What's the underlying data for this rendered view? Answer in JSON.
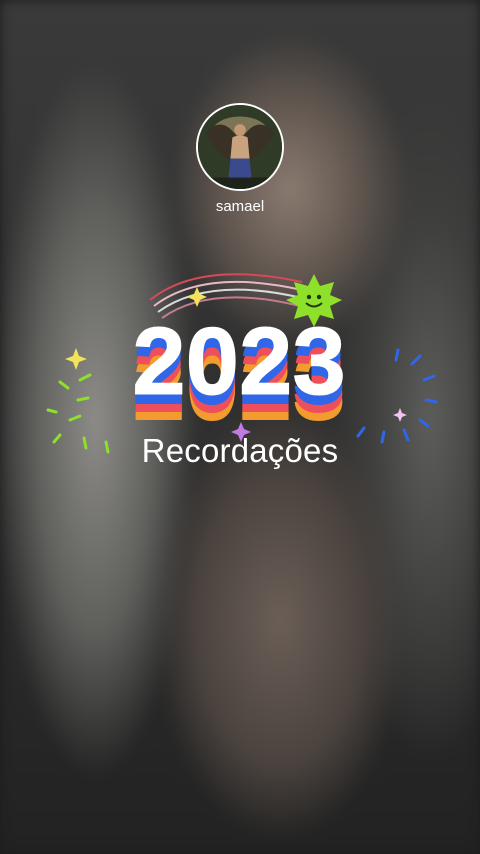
{
  "profile": {
    "username": "samael",
    "avatar_icon": "profile-photo"
  },
  "banner": {
    "year": "2023",
    "label": "Recordações",
    "stripe_colors": [
      "#2f67e8",
      "#ef4f5a",
      "#f29b2e"
    ],
    "accent_colors": [
      "#f2e24a",
      "#8ee02a",
      "#2f67e8",
      "#c07be0"
    ]
  }
}
